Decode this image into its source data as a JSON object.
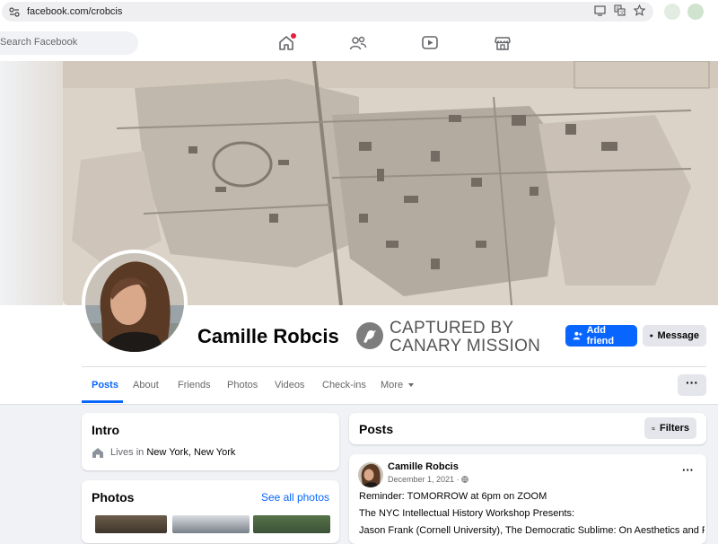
{
  "browser": {
    "url": "facebook.com/crobcis"
  },
  "nav": {
    "search_placeholder": "Search Facebook"
  },
  "profile": {
    "name": "Camille Robcis",
    "stamp_line1": "CAPTURED BY",
    "stamp_line2": "CANARY MISSION",
    "add_friend_label": "Add friend",
    "message_label": "Message",
    "more_dots": "···"
  },
  "tabs": [
    "Posts",
    "About",
    "Friends",
    "Photos",
    "Videos",
    "Check-ins",
    "More"
  ],
  "intro": {
    "title": "Intro",
    "lives_prefix": "Lives in",
    "city": "New York, New York"
  },
  "photos": {
    "title": "Photos",
    "see_all": "See all photos"
  },
  "posts_header": {
    "title": "Posts",
    "filters_label": "Filters"
  },
  "post": {
    "author": "Camille Robcis",
    "date": "December 1, 2021 ·",
    "options": "···",
    "line1": "Reminder: TOMORROW at 6pm on ZOOM",
    "line2": "The NYC Intellectual History Workshop Presents:",
    "line3": "Jason Frank (Cornell University), The Democratic Sublime: On Aesthetics and Popular"
  },
  "colors": {
    "accent": "#0866ff",
    "notification": "#e41e3f",
    "page_bg": "#f0f2f5"
  }
}
